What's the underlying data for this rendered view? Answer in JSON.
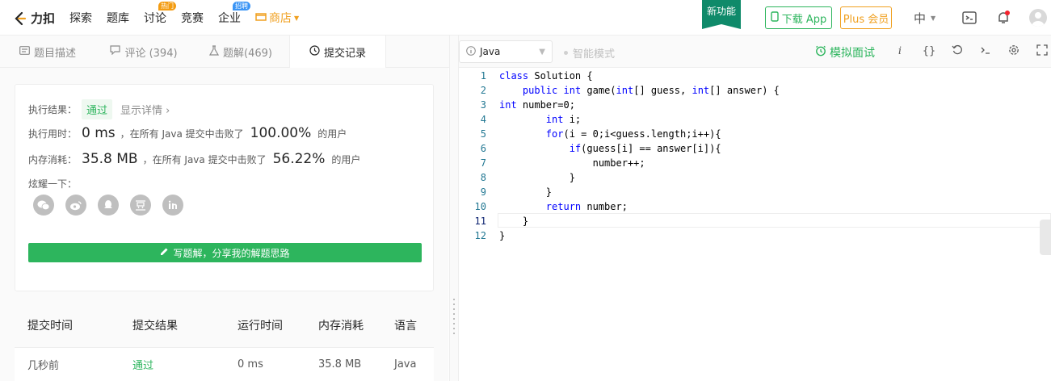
{
  "nav": {
    "logo": "力扣",
    "items": [
      {
        "label": "探索"
      },
      {
        "label": "题库"
      },
      {
        "label": "讨论",
        "badge": "热门"
      },
      {
        "label": "竞赛"
      },
      {
        "label": "企业",
        "badge": "招聘"
      }
    ],
    "store": "商店",
    "new_feature": "新功能",
    "download_app": "下载 App",
    "plus": "Plus 会员",
    "language": "中"
  },
  "tabs": [
    {
      "label": "题目描述"
    },
    {
      "label": "评论 (394)"
    },
    {
      "label": "题解(469)"
    },
    {
      "label": "提交记录"
    }
  ],
  "result": {
    "status_label": "执行结果：",
    "status_value": "通过",
    "detail_link": "显示详情 ›",
    "time_label": "执行用时：",
    "time_value": "0 ms",
    "time_mid": "，在所有 Java 提交中击败了",
    "time_pct": "100.00%",
    "time_tail": "的用户",
    "mem_label": "内存消耗：",
    "mem_value": "35.8 MB",
    "mem_mid": "，在所有 Java 提交中击败了",
    "mem_pct": "56.22%",
    "mem_tail": "的用户",
    "share_label": "炫耀一下：",
    "write_button": "写题解，分享我的解题思路"
  },
  "submissions": {
    "headers": [
      "提交时间",
      "提交结果",
      "运行时间",
      "内存消耗",
      "语言"
    ],
    "rows": [
      [
        "几秒前",
        "通过",
        "0 ms",
        "35.8 MB",
        "Java"
      ]
    ]
  },
  "editor": {
    "language": "Java",
    "smart_mode": "智能模式",
    "mock_interview": "模拟面试",
    "lines": [
      "class Solution {",
      "    public int game(int[] guess, int[] answer) {",
      "int number=0;",
      "        int i;",
      "        for(i = 0;i<guess.length;i++){",
      "            if(guess[i] == answer[i]){",
      "                number++;",
      "            }",
      "        }",
      "        return number;",
      "    }",
      "}"
    ]
  },
  "colors": {
    "accent_green": "#2db55d",
    "store_orange": "#f0a020",
    "feature_teal": "#0f8a6a"
  }
}
